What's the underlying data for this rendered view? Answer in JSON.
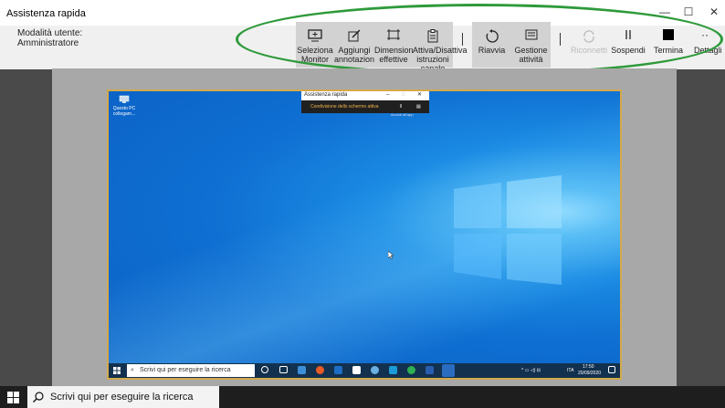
{
  "window": {
    "title": "Assistenza rapida",
    "controls": {
      "minimize": "—",
      "maximize": "☐",
      "close": "✕"
    }
  },
  "mode": {
    "label": "Modalità utente:",
    "value": "Amministratore"
  },
  "toolbar": {
    "buttons": [
      {
        "label": "Seleziona Monitor",
        "icon": "monitor-icon"
      },
      {
        "label": "Aggiungi annotazione",
        "icon": "pencil-icon"
      },
      {
        "label": "Dimensioni effettive",
        "icon": "fit-icon"
      },
      {
        "label": "Attiva/Disattiva istruzioni canale",
        "icon": "clipboard-icon"
      },
      {
        "label": "Riavvia",
        "icon": "restart-icon"
      },
      {
        "label": "Gestione attività",
        "icon": "task-manager-icon"
      },
      {
        "label": "Riconnetti",
        "icon": "reconnect-icon"
      },
      {
        "label": "Sospendi",
        "icon": "pause-icon"
      },
      {
        "label": "Termina",
        "icon": "stop-icon"
      },
      {
        "label": "Dettagli",
        "icon": "more-icon"
      }
    ]
  },
  "remote": {
    "mini_title": "Assistenza rapida",
    "mini_status": "Condivisione dello schermo attiva",
    "mini_sub": "Accedi all'app",
    "desktop_icon": "Questo PC collegam...",
    "taskbar_search": "Scrivi qui per eseguire la ricerca",
    "tray_lang": "ITA",
    "time": "17:50",
    "date": "20/09/2020"
  },
  "taskbar": {
    "search_placeholder": "Scrivi qui per eseguire la ricerca"
  }
}
